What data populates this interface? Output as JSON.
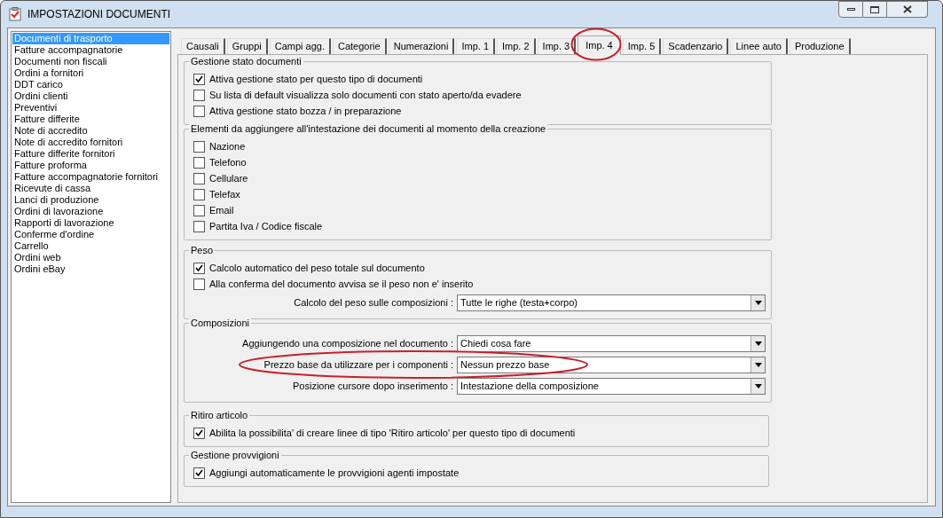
{
  "window": {
    "title": "IMPOSTAZIONI DOCUMENTI"
  },
  "sidebar": {
    "items": [
      {
        "label": "Documenti di trasporto",
        "selected": true
      },
      {
        "label": "Fatture accompagnatorie",
        "selected": false
      },
      {
        "label": "Documenti non fiscali",
        "selected": false
      },
      {
        "label": "Ordini a fornitori",
        "selected": false
      },
      {
        "label": "DDT carico",
        "selected": false
      },
      {
        "label": "Ordini clienti",
        "selected": false
      },
      {
        "label": "Preventivi",
        "selected": false
      },
      {
        "label": "Fatture differite",
        "selected": false
      },
      {
        "label": "Note di accredito",
        "selected": false
      },
      {
        "label": "Note di accredito fornitori",
        "selected": false
      },
      {
        "label": "Fatture differite fornitori",
        "selected": false
      },
      {
        "label": "Fatture proforma",
        "selected": false
      },
      {
        "label": "Fatture accompagnatorie fornitori",
        "selected": false
      },
      {
        "label": "Ricevute di cassa",
        "selected": false
      },
      {
        "label": "Lanci di produzione",
        "selected": false
      },
      {
        "label": "Ordini di lavorazione",
        "selected": false
      },
      {
        "label": "Rapporti di lavorazione",
        "selected": false
      },
      {
        "label": "Conferme d'ordine",
        "selected": false
      },
      {
        "label": "Carrello",
        "selected": false
      },
      {
        "label": "Ordini web",
        "selected": false
      },
      {
        "label": "Ordini eBay",
        "selected": false
      }
    ]
  },
  "tabs": [
    {
      "label": "Causali",
      "selected": false
    },
    {
      "label": "Gruppi",
      "selected": false
    },
    {
      "label": "Campi agg.",
      "selected": false
    },
    {
      "label": "Categorie",
      "selected": false
    },
    {
      "label": "Numerazioni",
      "selected": false
    },
    {
      "label": "Imp. 1",
      "selected": false
    },
    {
      "label": "Imp. 2",
      "selected": false
    },
    {
      "label": "Imp. 3",
      "selected": false
    },
    {
      "label": "Imp. 4",
      "selected": true,
      "circled": true
    },
    {
      "label": "Imp. 5",
      "selected": false
    },
    {
      "label": "Scadenzario",
      "selected": false
    },
    {
      "label": "Linee auto",
      "selected": false
    },
    {
      "label": "Produzione",
      "selected": false
    }
  ],
  "groups": [
    {
      "title": "Gestione stato documenti",
      "items": [
        {
          "kind": "checkbox",
          "label": "Attiva gestione stato per questo tipo di documenti",
          "checked": true
        },
        {
          "kind": "checkbox",
          "label": "Su lista di default visualizza solo documenti con stato aperto/da evadere",
          "checked": false
        },
        {
          "kind": "checkbox",
          "label": "Attiva gestione stato bozza / in preparazione",
          "checked": false
        }
      ]
    },
    {
      "title": "Elementi da aggiungere all'intestazione dei documenti al momento della creazione",
      "items": [
        {
          "kind": "checkbox",
          "label": "Nazione",
          "checked": false
        },
        {
          "kind": "checkbox",
          "label": "Telefono",
          "checked": false
        },
        {
          "kind": "checkbox",
          "label": "Cellulare",
          "checked": false
        },
        {
          "kind": "checkbox",
          "label": "Telefax",
          "checked": false
        },
        {
          "kind": "checkbox",
          "label": "Email",
          "checked": false
        },
        {
          "kind": "checkbox",
          "label": "Partita Iva / Codice fiscale",
          "checked": false
        }
      ]
    },
    {
      "title": "Peso",
      "items": [
        {
          "kind": "checkbox",
          "label": "Calcolo automatico del peso totale sul documento",
          "checked": true
        },
        {
          "kind": "checkbox",
          "label": "Alla conferma del documento avvisa se il peso non e' inserito",
          "checked": false
        },
        {
          "kind": "select",
          "label": "Calcolo del peso sulle composizioni :",
          "value": "Tutte le righe (testa+corpo)"
        }
      ]
    },
    {
      "title": "Composizioni",
      "items": [
        {
          "kind": "select",
          "label": "Aggiungendo una composizione nel documento :",
          "value": "Chiedi cosa fare"
        },
        {
          "kind": "select",
          "label": "Prezzo base da utilizzare per i componenti :",
          "value": "Nessun prezzo base",
          "circled": true
        },
        {
          "kind": "select",
          "label": "Posizione cursore dopo inserimento :",
          "value": "Intestazione della composizione"
        }
      ]
    },
    {
      "title": "Ritiro articolo",
      "items": [
        {
          "kind": "checkbox",
          "label": "Abilita la possibilita' di creare linee di tipo 'Ritiro articolo' per questo tipo di documenti",
          "checked": true
        }
      ]
    },
    {
      "title": "Gestione provvigioni",
      "items": [
        {
          "kind": "checkbox",
          "label": "Aggiungi automaticamente le provvigioni agenti impostate",
          "checked": true
        }
      ]
    }
  ]
}
